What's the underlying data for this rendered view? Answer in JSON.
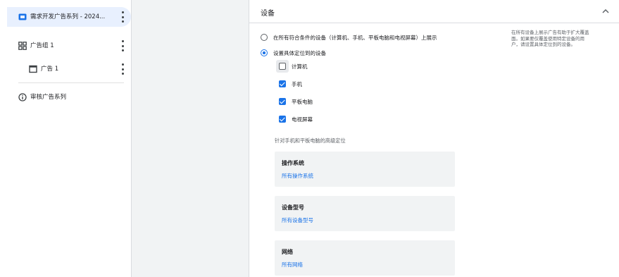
{
  "sidebar": {
    "items": [
      {
        "label": "需求开发广告系列 - 2024...",
        "icon": "campaign-icon"
      },
      {
        "label": "广告组 1",
        "icon": "ad-group-icon"
      },
      {
        "label": "广告 1",
        "icon": "ad-icon"
      },
      {
        "label": "审核广告系列",
        "icon": "info-icon"
      }
    ]
  },
  "devices": {
    "title": "设备",
    "radio_all": "在所有符合条件的设备（计算机、手机、平板电脑和电视屏幕）上展示",
    "radio_specific": "设置具体定位到的设备",
    "checkboxes": [
      {
        "label": "计算机",
        "checked": false
      },
      {
        "label": "手机",
        "checked": true
      },
      {
        "label": "平板电脑",
        "checked": true
      },
      {
        "label": "电视屏幕",
        "checked": true
      }
    ],
    "side_note": "在所有设备上展示广告有助于扩大覆盖面。如果要仅覆盖使用特定设备的用户，请设置具体定位到的设备。",
    "advanced_label": "针对手机和平板电脑的高级定位",
    "panels": [
      {
        "title": "操作系统",
        "link": "所有操作系统"
      },
      {
        "title": "设备型号",
        "link": "所有设备型号"
      },
      {
        "title": "网络",
        "link": "所有网络"
      }
    ]
  },
  "colors": {
    "accent": "#1a73e8",
    "active_bg": "#e8f0fe"
  }
}
